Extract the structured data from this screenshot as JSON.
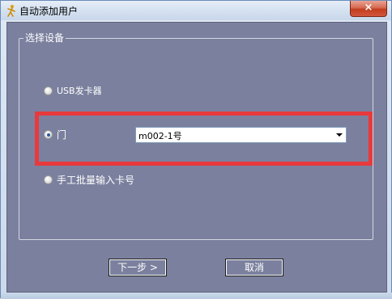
{
  "window": {
    "title": "自动添加用户",
    "close_label": "×"
  },
  "group": {
    "label": "选择设备"
  },
  "options": {
    "usb_label": "USB发卡器",
    "door_label": "门",
    "manual_label": "手工批量输入卡号",
    "selected": "door"
  },
  "door_select": {
    "value": "m002-1号"
  },
  "buttons": {
    "next_label": "下一步 >",
    "cancel_label": "取消"
  },
  "colors": {
    "client_bg": "#7b809e",
    "highlight": "#e8393c",
    "close_button": "#c8452a"
  }
}
